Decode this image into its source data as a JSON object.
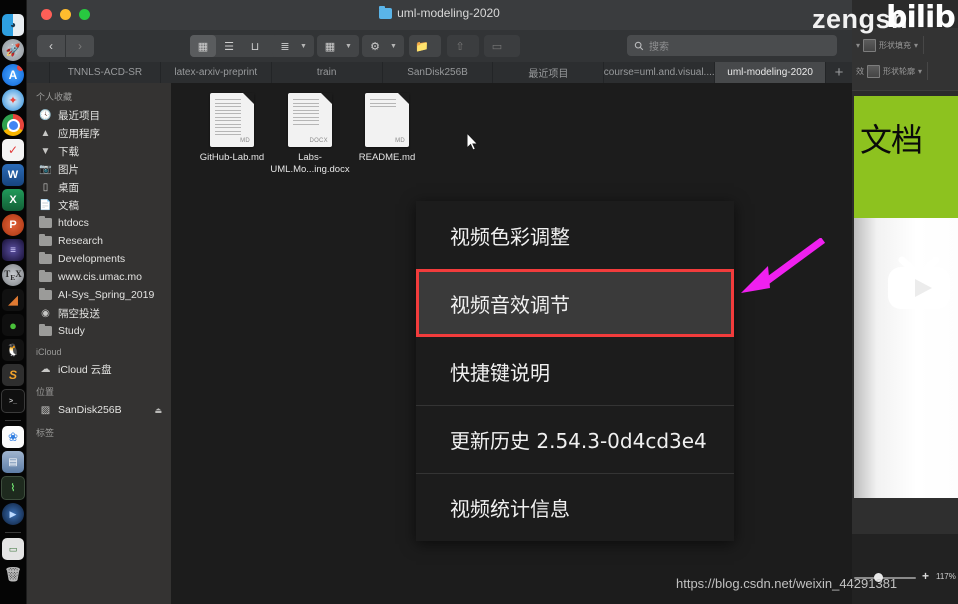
{
  "window": {
    "title": "uml-modeling-2020",
    "traffic_lights": [
      "close",
      "minimize",
      "zoom"
    ]
  },
  "toolbar": {
    "back_label": "‹",
    "forward_label": "›",
    "view_modes": [
      {
        "name": "icon-view",
        "glyph": "▦",
        "active": true
      },
      {
        "name": "list-view",
        "glyph": "☰",
        "active": false
      },
      {
        "name": "column-view",
        "glyph": "⊔",
        "active": false
      },
      {
        "name": "gallery-view",
        "glyph": "▓",
        "active": false
      }
    ],
    "arrange_glyph": "≣",
    "group_glyph": "▦",
    "action_glyph": "⚙",
    "folder_glyph": "὜0",
    "share_glyph": "⇧",
    "tag_glyph": "▭"
  },
  "search": {
    "placeholder": "搜索",
    "value": "",
    "icon": "search-icon"
  },
  "tabs": [
    {
      "label": "TNNLS-ACD-SR",
      "active": false
    },
    {
      "label": "latex-arxiv-preprint",
      "active": false
    },
    {
      "label": "train",
      "active": false
    },
    {
      "label": "SanDisk256B",
      "active": false
    },
    {
      "label": "最近项目",
      "active": false
    },
    {
      "label": "course=uml.and.visual....",
      "active": false
    },
    {
      "label": "uml-modeling-2020",
      "active": true
    }
  ],
  "tab_add_label": "+",
  "sidebar": {
    "sections": [
      {
        "header": "个人收藏",
        "items": [
          {
            "label": "最近项目",
            "icon": "recents-icon"
          },
          {
            "label": "应用程序",
            "icon": "applications-icon"
          },
          {
            "label": "下载",
            "icon": "downloads-icon"
          },
          {
            "label": "图片",
            "icon": "pictures-icon"
          },
          {
            "label": "桌面",
            "icon": "desktop-icon"
          },
          {
            "label": "文稿",
            "icon": "documents-icon"
          },
          {
            "label": "htdocs",
            "icon": "folder-icon"
          },
          {
            "label": "Research",
            "icon": "folder-icon"
          },
          {
            "label": "Developments",
            "icon": "folder-icon"
          },
          {
            "label": "www.cis.umac.mo",
            "icon": "folder-icon"
          },
          {
            "label": "AI-Sys_Spring_2019",
            "icon": "folder-icon"
          },
          {
            "label": "隔空投送",
            "icon": "airdrop-icon"
          },
          {
            "label": "Study",
            "icon": "folder-icon"
          }
        ]
      },
      {
        "header": "iCloud",
        "items": [
          {
            "label": "iCloud 云盘",
            "icon": "icloud-icon"
          }
        ]
      },
      {
        "header": "位置",
        "items": [
          {
            "label": "SanDisk256B",
            "icon": "drive-icon",
            "eject": "⏏"
          }
        ]
      },
      {
        "header": "标签",
        "items": []
      }
    ]
  },
  "files": [
    {
      "name": "GitHub-Lab.md",
      "kind": "MD"
    },
    {
      "name": "Labs-UML.Mo...ing.docx",
      "kind": "DOCX"
    },
    {
      "name": "README.md",
      "kind": "MD"
    }
  ],
  "context_menu": {
    "items": [
      {
        "label": "视频色彩调整",
        "selected": false,
        "divider_above": false
      },
      {
        "label": "视频音效调节",
        "selected": true,
        "divider_above": false
      },
      {
        "label": "快捷键说明",
        "selected": false,
        "divider_above": false
      },
      {
        "label": "更新历史 2.54.3-0d4cd3e4",
        "selected": false,
        "divider_above": true
      },
      {
        "label": "视频统计信息",
        "selected": false,
        "divider_above": true
      }
    ],
    "highlight_color": "#f23c3c",
    "arrow_color": "#f020f0"
  },
  "background_app": {
    "ribbon": [
      {
        "label": "形状填充"
      },
      {
        "label": "形状轮廓"
      }
    ],
    "ribbon_extra": "效",
    "slide_text": "文档",
    "slide_color": "#8dc21f",
    "zoom_level": "117%",
    "zoom_plus": "+"
  },
  "watermarks": {
    "csdn": "https://blog.csdn.net/weixin_44291381",
    "user": "zengsn",
    "brand": "bilib"
  },
  "dock": {
    "items": [
      {
        "name": "finder",
        "color": "#2e9fe0",
        "glyph": ""
      },
      {
        "name": "launchpad",
        "color": "#9aa0a6",
        "glyph": "🚀"
      },
      {
        "name": "app-store",
        "color": "#1f7ef0",
        "glyph": "A"
      },
      {
        "name": "safari",
        "color": "#2a8ae0",
        "glyph": "✦"
      },
      {
        "name": "chrome",
        "color": "#2fa24f",
        "glyph": "◉"
      },
      {
        "name": "dash",
        "color": "#f0f0f0",
        "glyph": "✓"
      },
      {
        "name": "word",
        "color": "#1b5aa8",
        "glyph": "W"
      },
      {
        "name": "excel",
        "color": "#1a7a45",
        "glyph": "X"
      },
      {
        "name": "powerpoint",
        "color": "#c5431e",
        "glyph": "P"
      },
      {
        "name": "astronomy",
        "color": "#2b1f4a",
        "glyph": "≡"
      },
      {
        "name": "texshop",
        "color": "#8f9296",
        "glyph": "T"
      },
      {
        "name": "matlab",
        "color": "#d35417",
        "glyph": "◢"
      },
      {
        "name": "wechat",
        "color": "#3fbf35",
        "glyph": "●"
      },
      {
        "name": "qq",
        "color": "#1c1c1c",
        "glyph": "🐧"
      },
      {
        "name": "sublime-text",
        "color": "#3a3a3a",
        "glyph": "S"
      },
      {
        "name": "terminal",
        "color": "#151515",
        "glyph": ">_"
      },
      {
        "name": "baidu-netdisk",
        "color": "#f5f5f5",
        "glyph": "❀"
      },
      {
        "name": "preview",
        "color": "#7b8fae",
        "glyph": "▤"
      },
      {
        "name": "activity-monitor",
        "color": "#2a3a2a",
        "glyph": "⌇"
      },
      {
        "name": "quicktime",
        "color": "#1d3a63",
        "glyph": "▶"
      },
      {
        "name": "display",
        "color": "#dedede",
        "glyph": "▭"
      },
      {
        "name": "trash",
        "color": "#6a6a6a",
        "glyph": "🗑"
      }
    ]
  }
}
